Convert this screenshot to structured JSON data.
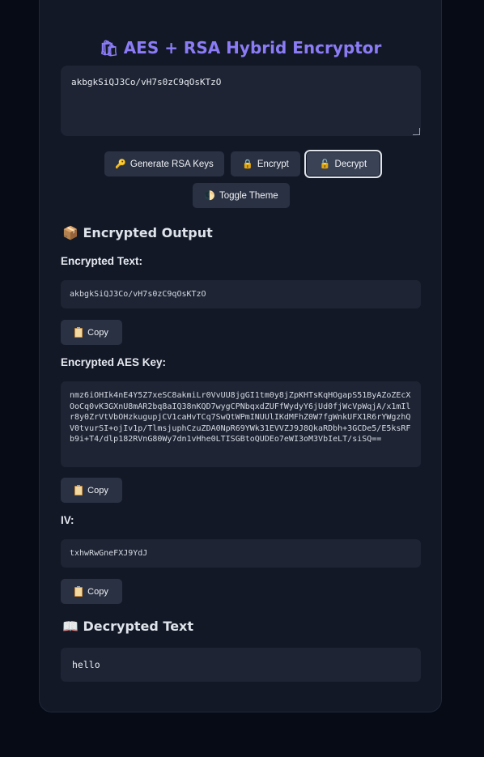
{
  "app": {
    "title": "AES + RSA Hybrid Encryptor",
    "title_icon": "lock-bag-icon"
  },
  "input": {
    "value": "akbgkSiQJ3Co/vH7s0zC9qOsKTzO"
  },
  "buttons": {
    "generate": {
      "icon": "🔑",
      "label": "Generate RSA Keys"
    },
    "encrypt": {
      "icon": "🔒",
      "label": "Encrypt"
    },
    "decrypt": {
      "icon": "🔓",
      "label": "Decrypt"
    },
    "toggle": {
      "icon": "🌓",
      "label": "Toggle Theme"
    }
  },
  "encrypted_output": {
    "heading_icon": "📦",
    "heading": "Encrypted Output",
    "text_label": "Encrypted Text:",
    "text_value": "akbgkSiQJ3Co/vH7s0zC9qOsKTzO",
    "aes_label": "Encrypted AES Key:",
    "aes_value": "nmz6iOHIk4nE4Y5Z7xeSC8akmiLr0VvUU8jgGI1tm0y8jZpKHTsKqHOgapS51ByAZoZEcXOoCq0vK3GXnU8mAR2bq8aIQ38nKQD7wygCPNbqxdZUFfWydyY6jUd0fjWcVpWqjA/x1mIlr8y0ZrVtVbOHzkugupjCV1caHvTCq7SwQtWPmINUUlIKdMFhZ0W7fgWnkUFX1R6rYWgzhQV0tvurSI+ojIv1p/TlmsjuphCzuZDA0NpR69YWk31EVVZJ9J8QkaRDbh+3GCDe5/E5ksRFb9i+T4/dlp182RVnG80Wy7dn1vHhe0LTISGBtoQUDEo7eWI3oM3VbIeLT/siSQ==",
    "iv_label": "IV:",
    "iv_value": "txhwRwGneFXJ9YdJ",
    "copy_label": "Copy"
  },
  "decrypted": {
    "heading_icon": "📖",
    "heading": "Decrypted Text",
    "value": "hello"
  }
}
